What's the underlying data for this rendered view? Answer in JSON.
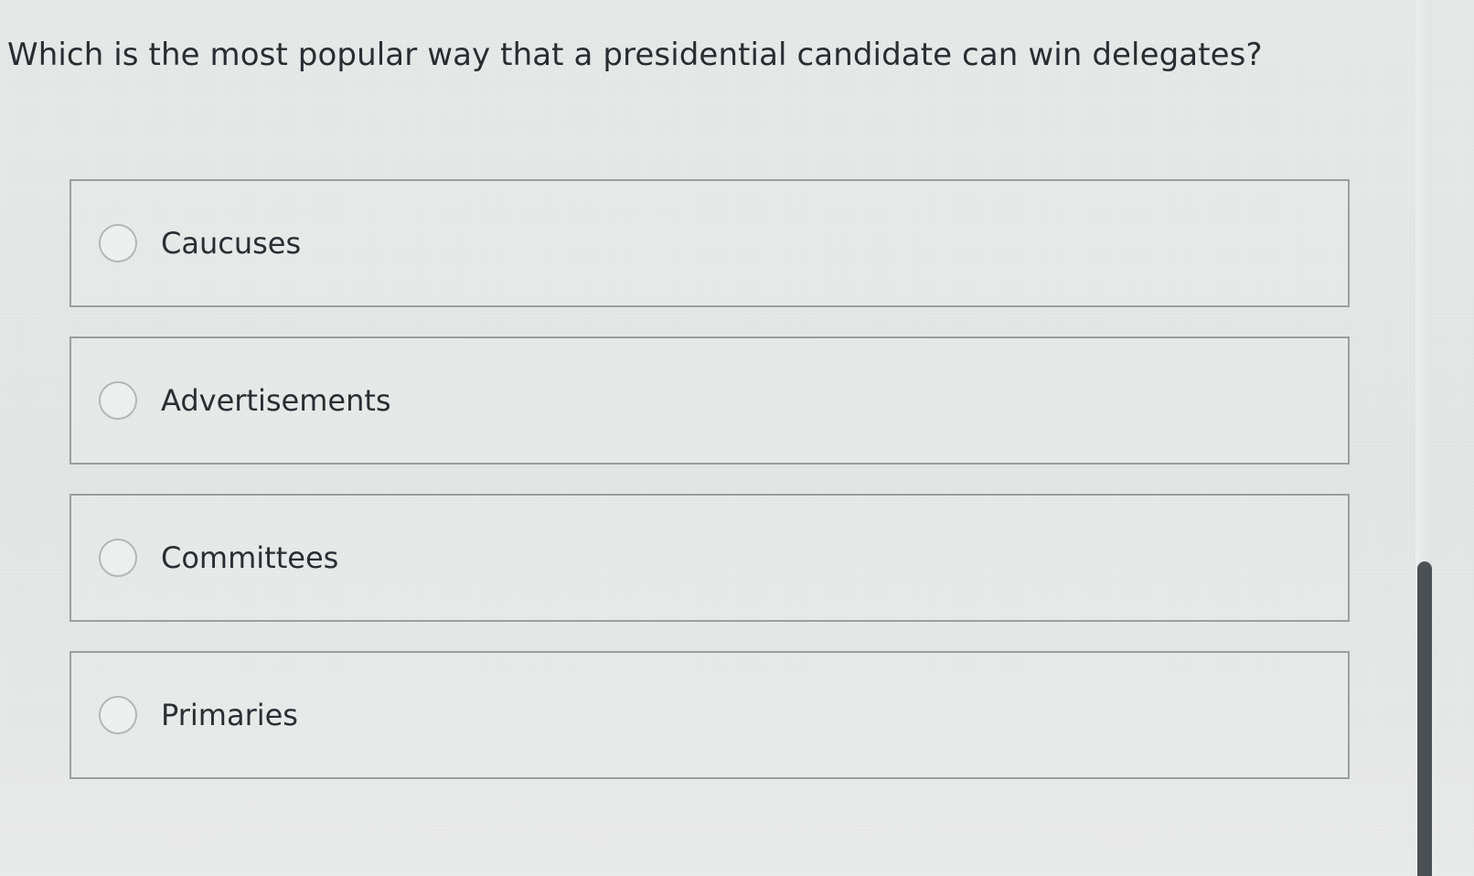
{
  "question": {
    "text": "Which is the most popular way that a presidential candidate can win delegates?"
  },
  "options": [
    {
      "label": "Caucuses",
      "selected": false
    },
    {
      "label": "Advertisements",
      "selected": false
    },
    {
      "label": "Committees",
      "selected": false
    },
    {
      "label": "Primaries",
      "selected": false
    }
  ],
  "colors": {
    "background": "#e1e5e3",
    "option_border": "#9aa09d",
    "text": "#2b2d33",
    "radio_border": "#b3b8b6",
    "scroll_thumb": "#4b5054"
  },
  "icons": {
    "radio": "radio-unselected-icon"
  }
}
